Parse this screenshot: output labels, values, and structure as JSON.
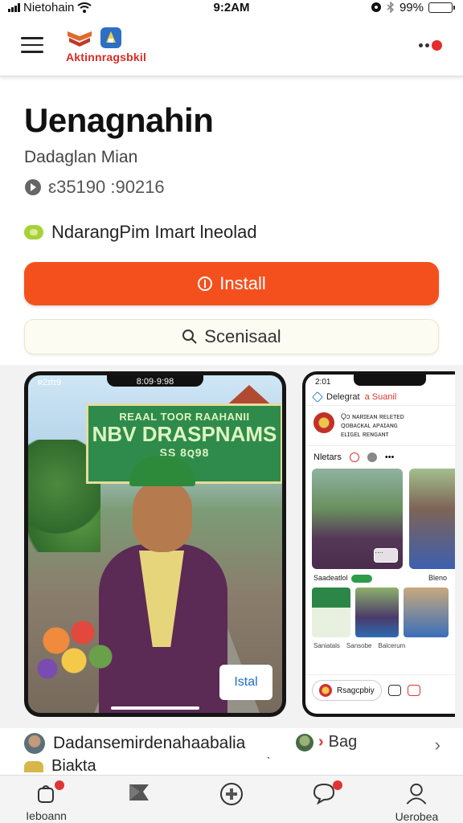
{
  "status_bar": {
    "carrier": "Nietohain",
    "time": "9:2AM",
    "battery_percent": "99%",
    "battery_level": 0.9
  },
  "header": {
    "brand_name": "Aktinnragsbkil",
    "menu_icon": "hamburger-menu-icon",
    "more_icon": "more-dots-icon"
  },
  "app": {
    "title": "Uenagnahin",
    "developer": "Dadaglan Mian",
    "meta": "ɛ35190 :90216",
    "tagline": "NdarangPim Imart lneolad",
    "install_label": "Install",
    "secondary_label": "Scenisaal"
  },
  "screenshot1": {
    "status_left": "ʀ2ɪfɪ9",
    "clock": "8:09·9:98",
    "banner_line1": "REAAL TOOR RAAHANII",
    "banner_line2": "NBV DRASPNAMS",
    "banner_line3": "SS 8ꞯ98",
    "install_label": "Istal"
  },
  "screenshot2": {
    "status_time": "2:01",
    "header_text": "Delegrat",
    "header_red": "a Suanil",
    "profile_line1": "Ǫɔ ɴᴀʀɪᴇᴀɴ ʀᴇʟᴇᴛᴇᴅ",
    "profile_line2": "ꞯᴏʙᴀᴄᴋᴀʟ ᴀᴘᴀɪᴀɴɢ",
    "profile_line3": "ᴇʟɪɢᴇʟ ʀᴇɴɢᴀɴᴛ",
    "tabs_label": "Nletars",
    "row_left": "Saadeatlol",
    "row_right": "Bleno",
    "captions": [
      "Saniatals",
      "Sansobe",
      "Balcerum"
    ],
    "chip_label": "Rsagcpbiy",
    "card_button": "····"
  },
  "list_row": {
    "item1_label": "Dadansemirdenahaabalia",
    "item1_sub": "Biakta",
    "item2_label": "Bag",
    "chevron": "›"
  },
  "bottom_nav": [
    {
      "label": "Ieboann",
      "icon": "notification-bag-icon",
      "badge": true
    },
    {
      "label": "",
      "icon": "flag-icon",
      "badge": false
    },
    {
      "label": "",
      "icon": "plus-circle-icon",
      "badge": false
    },
    {
      "label": "",
      "icon": "chat-bubble-icon",
      "badge": true
    },
    {
      "label": "Uerobea",
      "icon": "profile-icon",
      "badge": false
    }
  ]
}
